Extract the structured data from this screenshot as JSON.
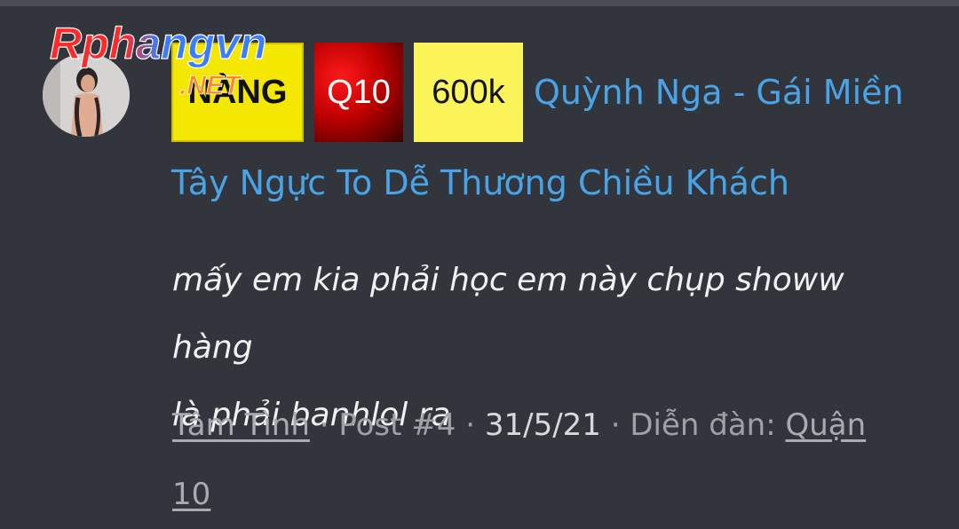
{
  "watermark": {
    "line1": "Rphangvn",
    "line2": ".NET"
  },
  "post": {
    "badges": [
      "NÀNG",
      "Q10",
      "600k"
    ],
    "title_line1": "Quỳnh Nga - Gái Miền",
    "title_line2": "Tây Ngực To Dễ Thương Chiều Khách",
    "snippet_line1": "mấy em kia phải học em này chụp showw hàng",
    "snippet_line2": "là phải banhlol ra",
    "author": "Tâm Tình",
    "separator": " · ",
    "post_number": "Post #4",
    "date": "31/5/21",
    "forum_label": "Diễn đàn: ",
    "forum_name_line1": "Quận",
    "forum_name_line2": "10"
  },
  "colors": {
    "background": "#33353d",
    "link_blue": "#48a4e6",
    "badge_yellow": "#f5e800",
    "badge_red": "#c00000",
    "badge_light_yellow": "#fbf55a"
  }
}
